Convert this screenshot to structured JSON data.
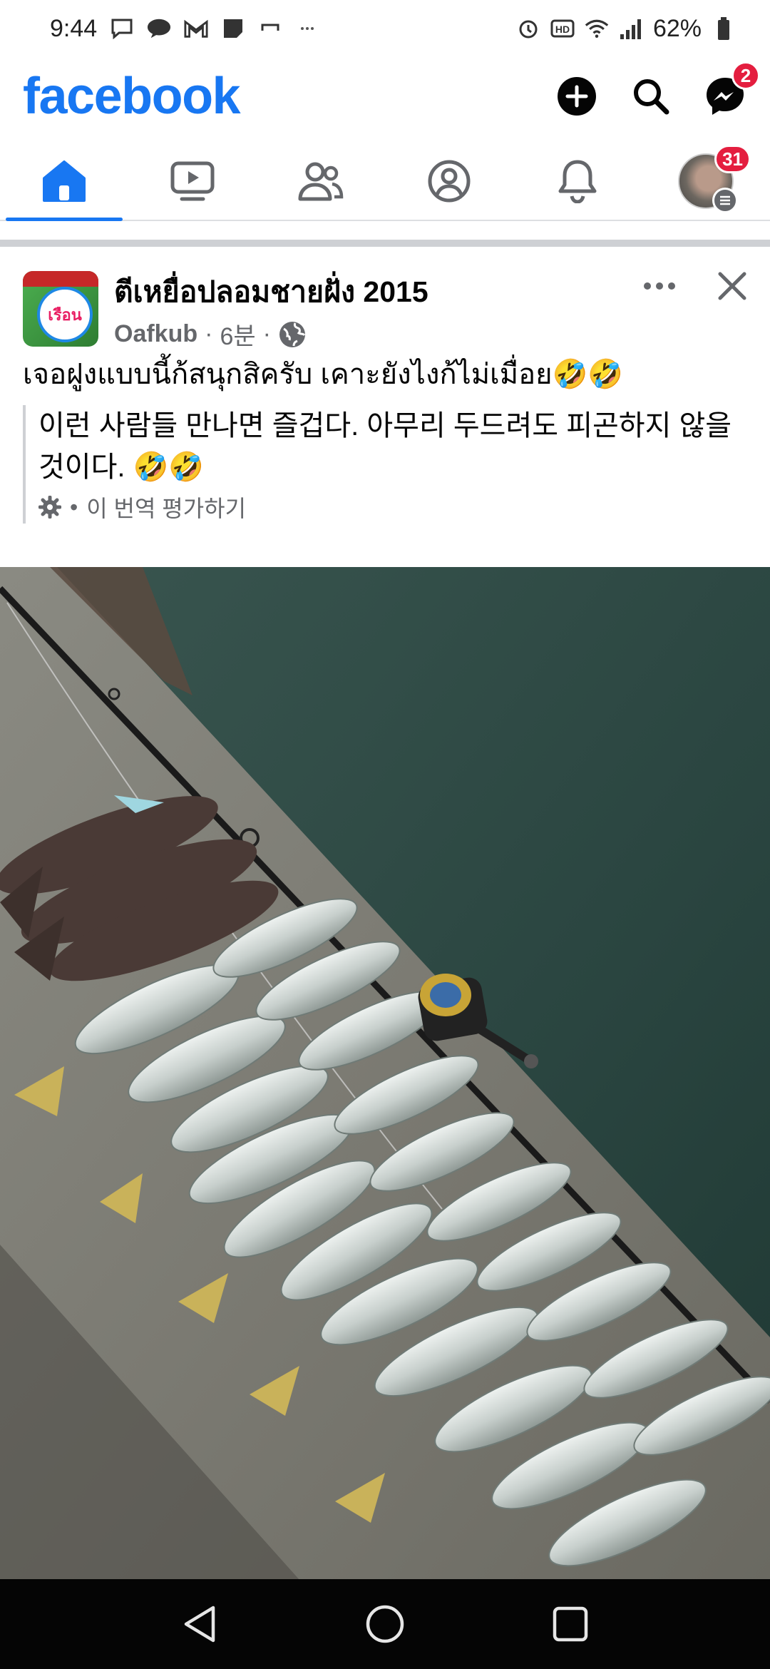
{
  "status_bar": {
    "time": "9:44",
    "battery": "62%"
  },
  "header": {
    "logo": "facebook",
    "messenger_badge": "2"
  },
  "tabs": {
    "profile_badge": "31"
  },
  "post": {
    "group_name": "ตีเหยื่อปลอมชายฝั่ง 2015",
    "author": "Oafkub",
    "separator": "·",
    "time": "6분",
    "body": "เจอฝูงแบบนี้ก้สนุกสิครับ เคาะยังไงก้ไม่เมื่อย🤣🤣",
    "translation": "이런 사람들 만나면 즐겁다. 아무리 두드려도 피곤하지 않을 것이다. 🤣🤣",
    "rate_translation": "이 번역 평가하기",
    "rate_dot": "•",
    "avatar_text": "เรือน"
  },
  "colors": {
    "brand": "#1877f2",
    "badge": "#e41e3f",
    "water": "#2f4a44",
    "concrete": "#7a7a72"
  }
}
